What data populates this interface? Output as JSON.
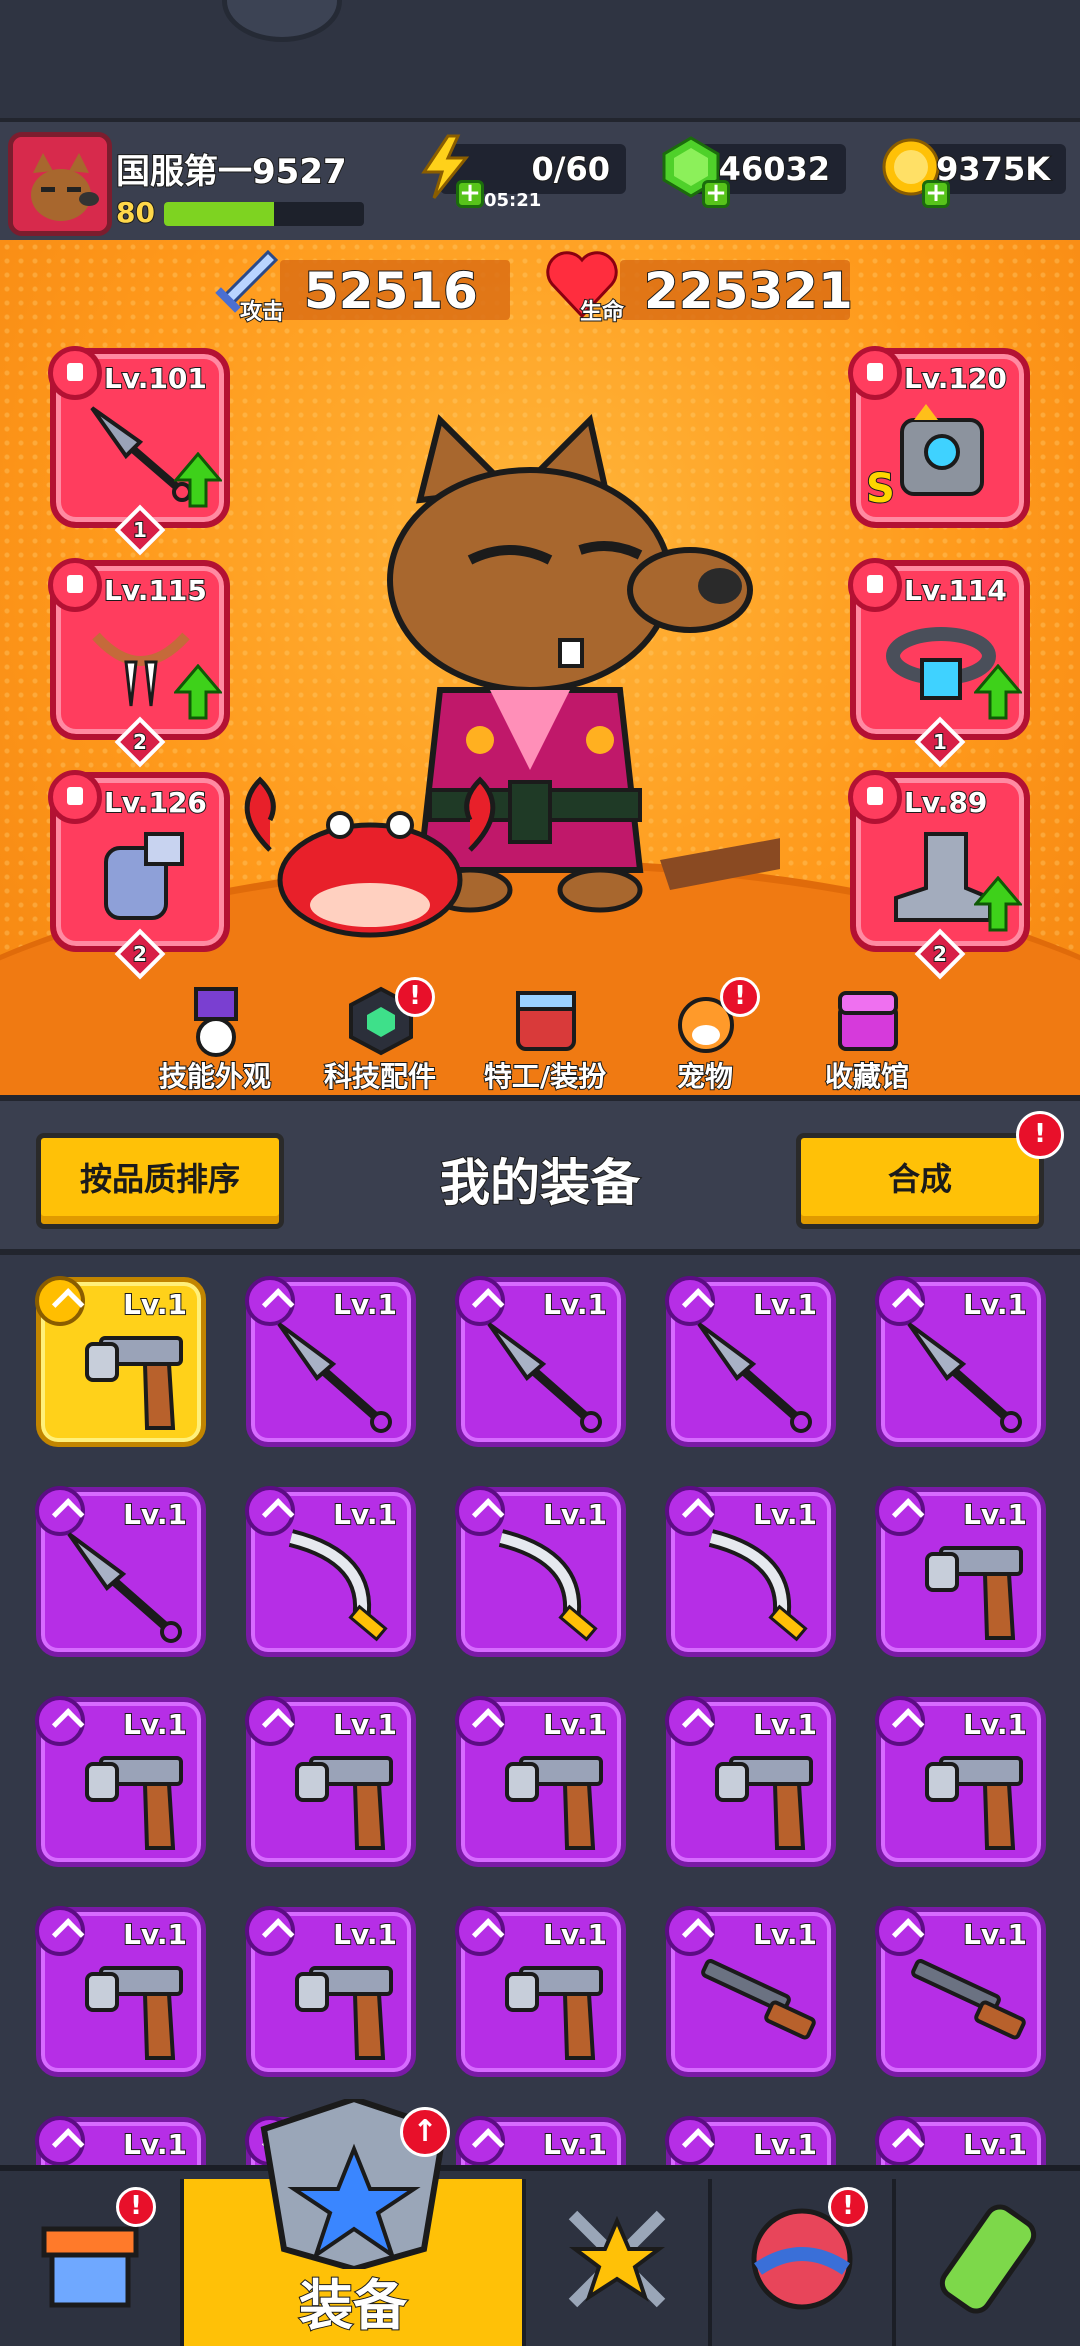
{
  "player": {
    "name": "国服第一9527",
    "level": "80",
    "xp_fraction": 0.55
  },
  "resources": {
    "energy": {
      "value": "0/60",
      "timer": "05:21"
    },
    "gems": {
      "value": "46032"
    },
    "gold": {
      "value": "9375K"
    }
  },
  "stats": {
    "attack": {
      "label": "攻击",
      "value": "52516"
    },
    "hp": {
      "label": "生命",
      "value": "225321"
    }
  },
  "equipped": {
    "left": [
      {
        "level": "Lv.101",
        "stars": "1",
        "upgradable": true
      },
      {
        "level": "Lv.115",
        "stars": "2",
        "upgradable": true
      },
      {
        "level": "Lv.126",
        "stars": "2",
        "upgradable": false
      }
    ],
    "right": [
      {
        "level": "Lv.120",
        "grade": "S",
        "upgradable": false
      },
      {
        "level": "Lv.114",
        "stars": "1",
        "upgradable": true
      },
      {
        "level": "Lv.89",
        "stars": "2",
        "upgradable": true
      }
    ]
  },
  "menu": [
    {
      "label": "技能外观",
      "alert": ""
    },
    {
      "label": "科技配件",
      "alert": "!"
    },
    {
      "label": "特工/装扮",
      "alert": ""
    },
    {
      "label": "宠物",
      "alert": "!"
    },
    {
      "label": "收藏馆",
      "alert": ""
    }
  ],
  "inventory": {
    "sort_label": "按品质排序",
    "title": "我的装备",
    "merge_label": "合成",
    "merge_alert": "!",
    "item_level": "Lv.1",
    "rows": [
      [
        "revolver-gold",
        "kunai",
        "kunai",
        "kunai",
        "kunai"
      ],
      [
        "kunai",
        "scimitar",
        "scimitar",
        "scimitar",
        "revolver"
      ],
      [
        "revolver",
        "revolver",
        "revolver",
        "revolver",
        "revolver"
      ],
      [
        "revolver",
        "revolver",
        "revolver",
        "shotgun",
        "shotgun"
      ],
      [
        "partial",
        "partial",
        "partial",
        "partial",
        "partial"
      ]
    ]
  },
  "nav": {
    "active_label": "装备",
    "alerts": {
      "shop": "!",
      "equip_up": "↑",
      "pets": "!"
    }
  },
  "colors": {
    "rare_purple": "#b62ee6",
    "legendary_gold": "#ffd11a",
    "equip_red": "#ff3d5e",
    "accent_yellow": "#ffc107"
  }
}
